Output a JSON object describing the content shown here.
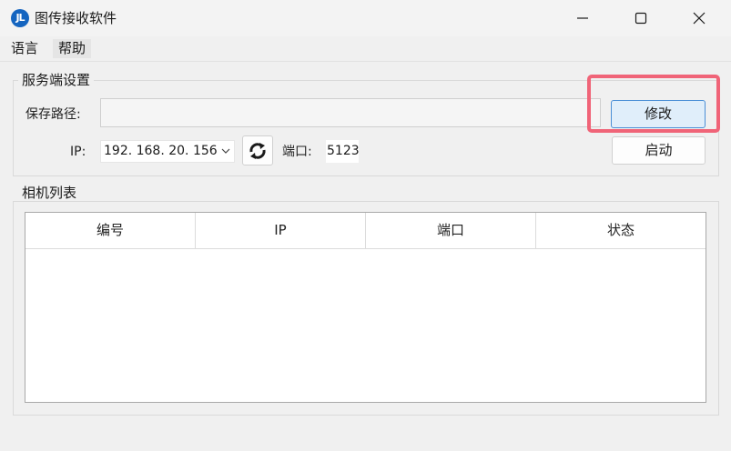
{
  "window": {
    "title": "图传接收软件",
    "icon_text": "JL",
    "controls": [
      "minimize-icon",
      "maximize-icon",
      "close-icon"
    ]
  },
  "menu": {
    "items": [
      "语言",
      "帮助"
    ]
  },
  "server_settings": {
    "group_title": "服务端设置",
    "save_path_label": "保存路径:",
    "save_path_value": "",
    "modify_button": "修改",
    "ip_label": "IP:",
    "ip_value": "192. 168. 20. 156",
    "refresh_icon": "refresh-icon",
    "port_label": "端口:",
    "port_value": "5123",
    "start_button": "启动"
  },
  "camera_list": {
    "group_title": "相机列表",
    "columns": [
      "编号",
      "IP",
      "端口",
      "状态"
    ],
    "rows": []
  },
  "colors": {
    "highlight": "#f06478",
    "modify_button_border": "#4b8fd6",
    "app_icon": "#1565c0"
  }
}
